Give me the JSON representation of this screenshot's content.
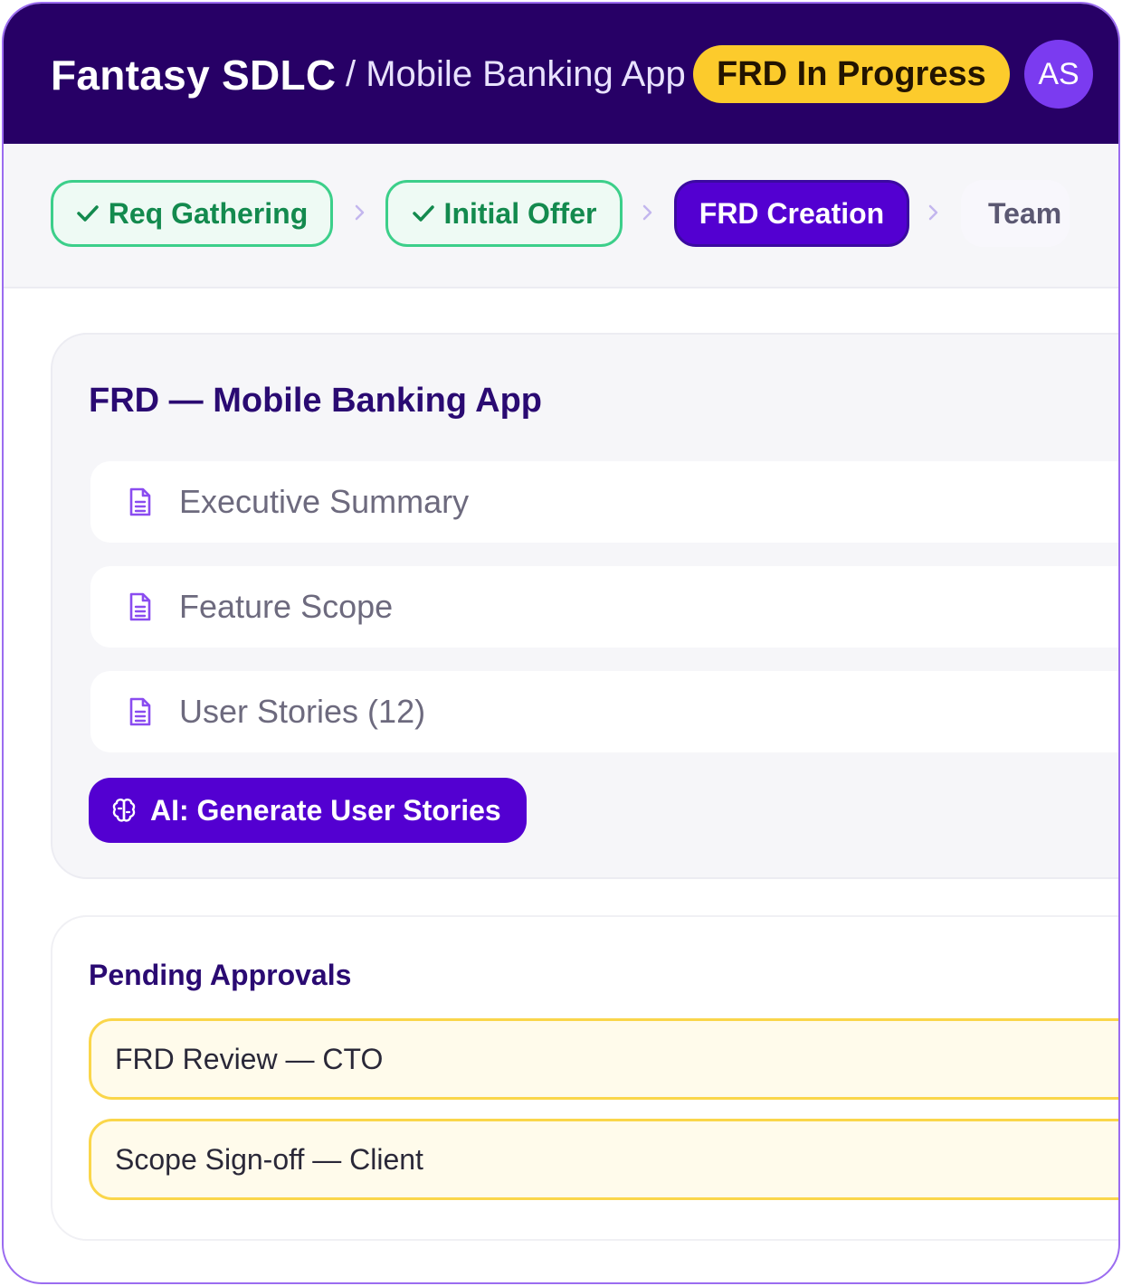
{
  "header": {
    "brand": "Fantasy SDLC",
    "breadcrumb": "/ Mobile Banking App",
    "status": "FRD In Progress",
    "avatar_initials": "AS"
  },
  "stepper": {
    "steps": [
      {
        "label": "Req Gathering",
        "state": "done"
      },
      {
        "label": "Initial Offer",
        "state": "done"
      },
      {
        "label": "FRD Creation",
        "state": "active"
      },
      {
        "label": "Team",
        "state": "todo"
      }
    ]
  },
  "frd": {
    "title": "FRD — Mobile Banking App",
    "sections": [
      {
        "label": "Executive Summary",
        "icon": "document-icon"
      },
      {
        "label": "Feature Scope",
        "icon": "document-icon"
      },
      {
        "label": "User Stories (12)",
        "icon": "document-icon"
      }
    ],
    "ai_button_label": "AI: Generate User Stories",
    "ai_button_icon": "brain-icon"
  },
  "approvals": {
    "title": "Pending Approvals",
    "items": [
      {
        "label": "FRD Review — CTO"
      },
      {
        "label": "Scope Sign-off — Client"
      }
    ]
  },
  "colors": {
    "header_bg": "#270066",
    "accent": "#5300d1",
    "status_pill": "#fccb2c",
    "done_green": "#3ccf8a",
    "approval_yellow": "#fad64a"
  }
}
